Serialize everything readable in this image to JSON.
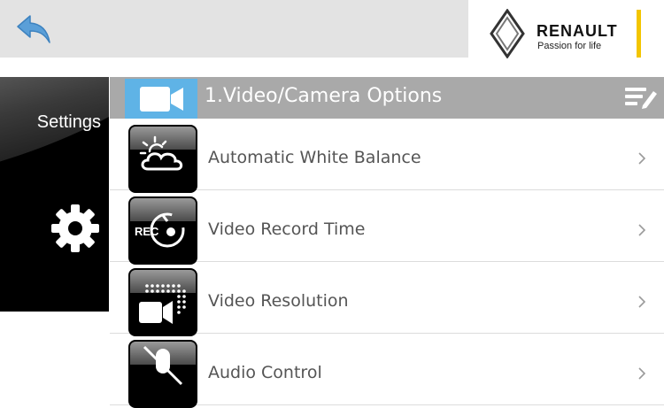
{
  "brand": {
    "name": "RENAULT",
    "tagline": "Passion for life",
    "accent": "#f3c500"
  },
  "sidebar": {
    "label": "Settings",
    "icon": "gear-icon"
  },
  "section": {
    "title": "1.Video/Camera Options",
    "icon": "video-camera-icon",
    "color": "#5fb3e6"
  },
  "items": [
    {
      "label": "Automatic White Balance",
      "icon": "weather-sun-cloud-icon"
    },
    {
      "label": "Video Record Time",
      "icon": "rec-timer-icon",
      "icon_text": "REC"
    },
    {
      "label": "Video Resolution",
      "icon": "resolution-camera-icon"
    },
    {
      "label": "Audio Control",
      "icon": "microphone-muted-icon"
    }
  ]
}
